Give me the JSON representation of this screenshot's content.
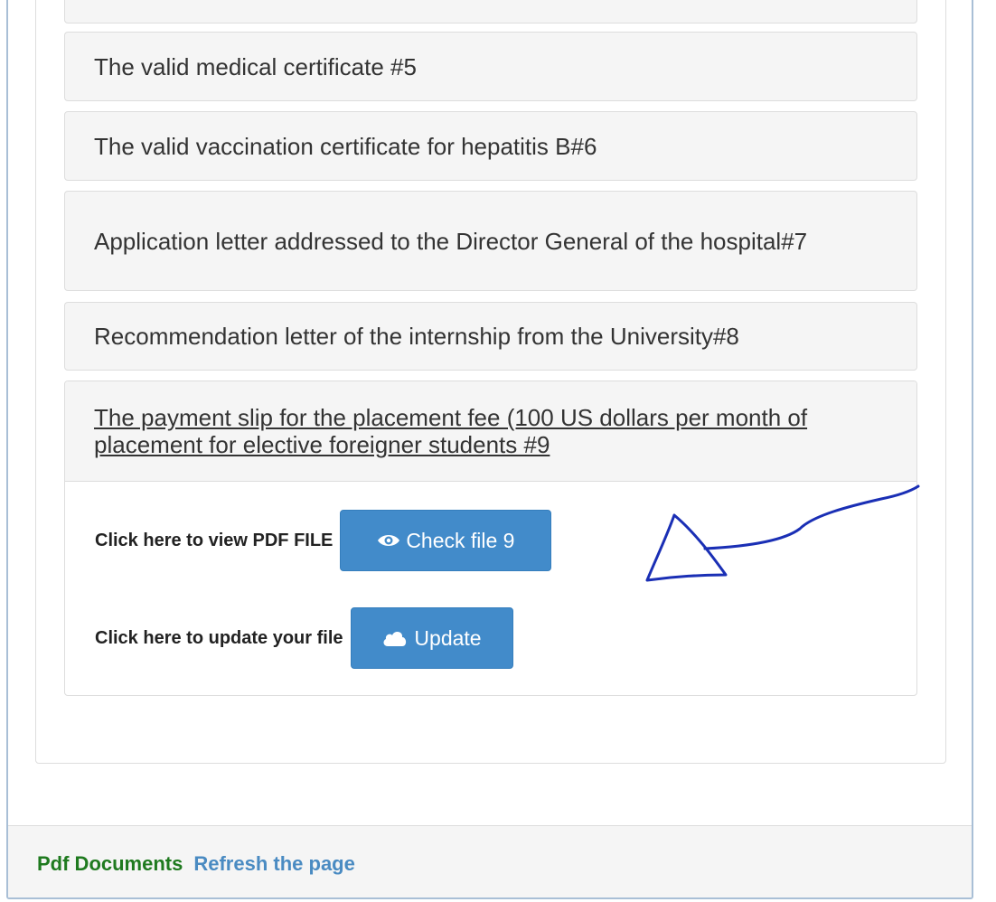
{
  "accordion": {
    "items": [
      {
        "label": "The valid medical certificate #5"
      },
      {
        "label": "The valid vaccination certificate for hepatitis B#6"
      },
      {
        "label": "Application letter addressed to the Director General of the hospital#7"
      },
      {
        "label": "Recommendation letter of the internship from the University#8"
      }
    ],
    "open_item": {
      "title": "The payment slip for the placement fee (100 US dollars per month of placement for elective foreigner students #9",
      "view_label": "Click here to view PDF FILE",
      "check_button": "Check file 9",
      "update_label": "Click here to update your file",
      "update_button": "Update"
    }
  },
  "footer": {
    "section_label": "Pdf Documents",
    "refresh_link": "Refresh the page"
  },
  "colors": {
    "primary_button": "#428bca",
    "annotation_ink": "#1a2fb5",
    "footer_green": "#1f7a1f",
    "footer_link": "#4a8bc2"
  },
  "icons": {
    "check_button_icon": "eye-icon",
    "update_button_icon": "cloud-icon"
  }
}
